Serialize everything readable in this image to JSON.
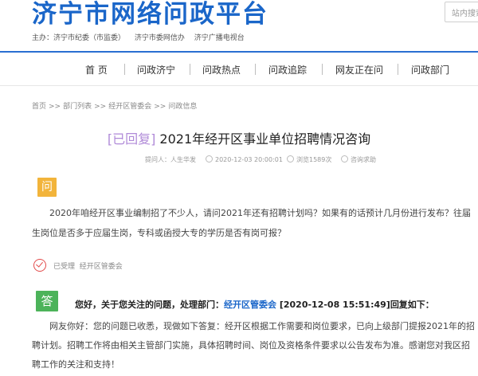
{
  "site": {
    "title": "济宁市网络问政平台",
    "search_placeholder": "站内搜索",
    "sponsors": [
      "主办：济宁市纪委（市监委）",
      "济宁市委网信办",
      "济宁广播电视台"
    ]
  },
  "nav": {
    "items": [
      "首 页",
      "问政济宁",
      "问政热点",
      "问政追踪",
      "网友正在问",
      "问政部门"
    ]
  },
  "breadcrumb": [
    "首页",
    "部门列表",
    "经开区管委会",
    "问政信息"
  ],
  "question": {
    "status_tag": "[已回复]",
    "title": "2021年经开区事业单位招聘情况咨询",
    "asker": "提问人：人生华发",
    "time": "2020-12-03 20:00:01",
    "views": "浏览1589次",
    "category": "咨询求助",
    "badge": "问",
    "content": "2020年咱经开区事业编制招了不少人，请问2021年还有招聘计划吗？如果有的话预计几月份进行发布？往届生岗位是否多于应届生岗，专科或函授大专的学历是否有岗可报？"
  },
  "status": {
    "text": "已受理",
    "dept": "经开区管委会"
  },
  "answer": {
    "badge": "答",
    "head_prefix": "您好，关于您关注的问题，处理部门：",
    "dept": "经开区管委会",
    "head_time": "[2020-12-08 15:51:49]",
    "head_suffix": "回复如下：",
    "content": "网友你好：您的问题已收悉，现做如下答复：经开区根据工作需要和岗位要求，已向上级部门提报2021年的招聘计划。招聘工作将由相关主管部门实施，具体招聘时间、岗位及资格条件要求以公告发布为准。感谢您对我区招聘工作的关注和支持！"
  },
  "colors": {
    "brand": "#1a66c9",
    "tag": "#b08ad8",
    "ask_badge": "#f2b43b",
    "answer_badge": "#4cb35a",
    "status_check": "#e24a4a"
  }
}
